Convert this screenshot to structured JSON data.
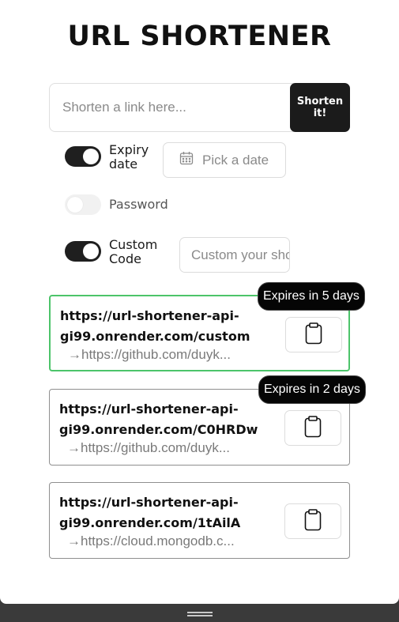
{
  "header": {
    "title": "URL SHORTENER"
  },
  "shorten_form": {
    "placeholder": "Shorten a link here...",
    "button_label": "Shorten it!"
  },
  "options": {
    "expiry": {
      "label_line1": "Expiry",
      "label_line2": "date",
      "enabled": true,
      "date_placeholder": "Pick a date"
    },
    "password": {
      "label": "Password",
      "enabled": false
    },
    "custom_code": {
      "label_line1": "Custom",
      "label_line2": "Code",
      "enabled": true,
      "placeholder": "Custom your short code"
    }
  },
  "links": [
    {
      "short_line1": "https://url-shortener-api-",
      "short_line2": "gi99.onrender.com/custom",
      "original": "https://github.com/duyk...",
      "badge": "Expires in 5 days",
      "active": true
    },
    {
      "short_line1": "https://url-shortener-api-",
      "short_line2": "gi99.onrender.com/C0HRDw",
      "original": "https://github.com/duyk...",
      "badge": "Expires in 2 days",
      "active": false
    },
    {
      "short_line1": "https://url-shortener-api-",
      "short_line2": "gi99.onrender.com/1tAilA",
      "original": "https://cloud.mongodb.c...",
      "badge": "",
      "active": false
    }
  ],
  "icons": {
    "calendar": "calendar-icon",
    "clipboard": "clipboard-icon",
    "arrow": "arrow-right-icon"
  },
  "colors": {
    "primary": "#1b1b1b",
    "active_border": "#4cc46a",
    "badge_bg": "#050505"
  }
}
